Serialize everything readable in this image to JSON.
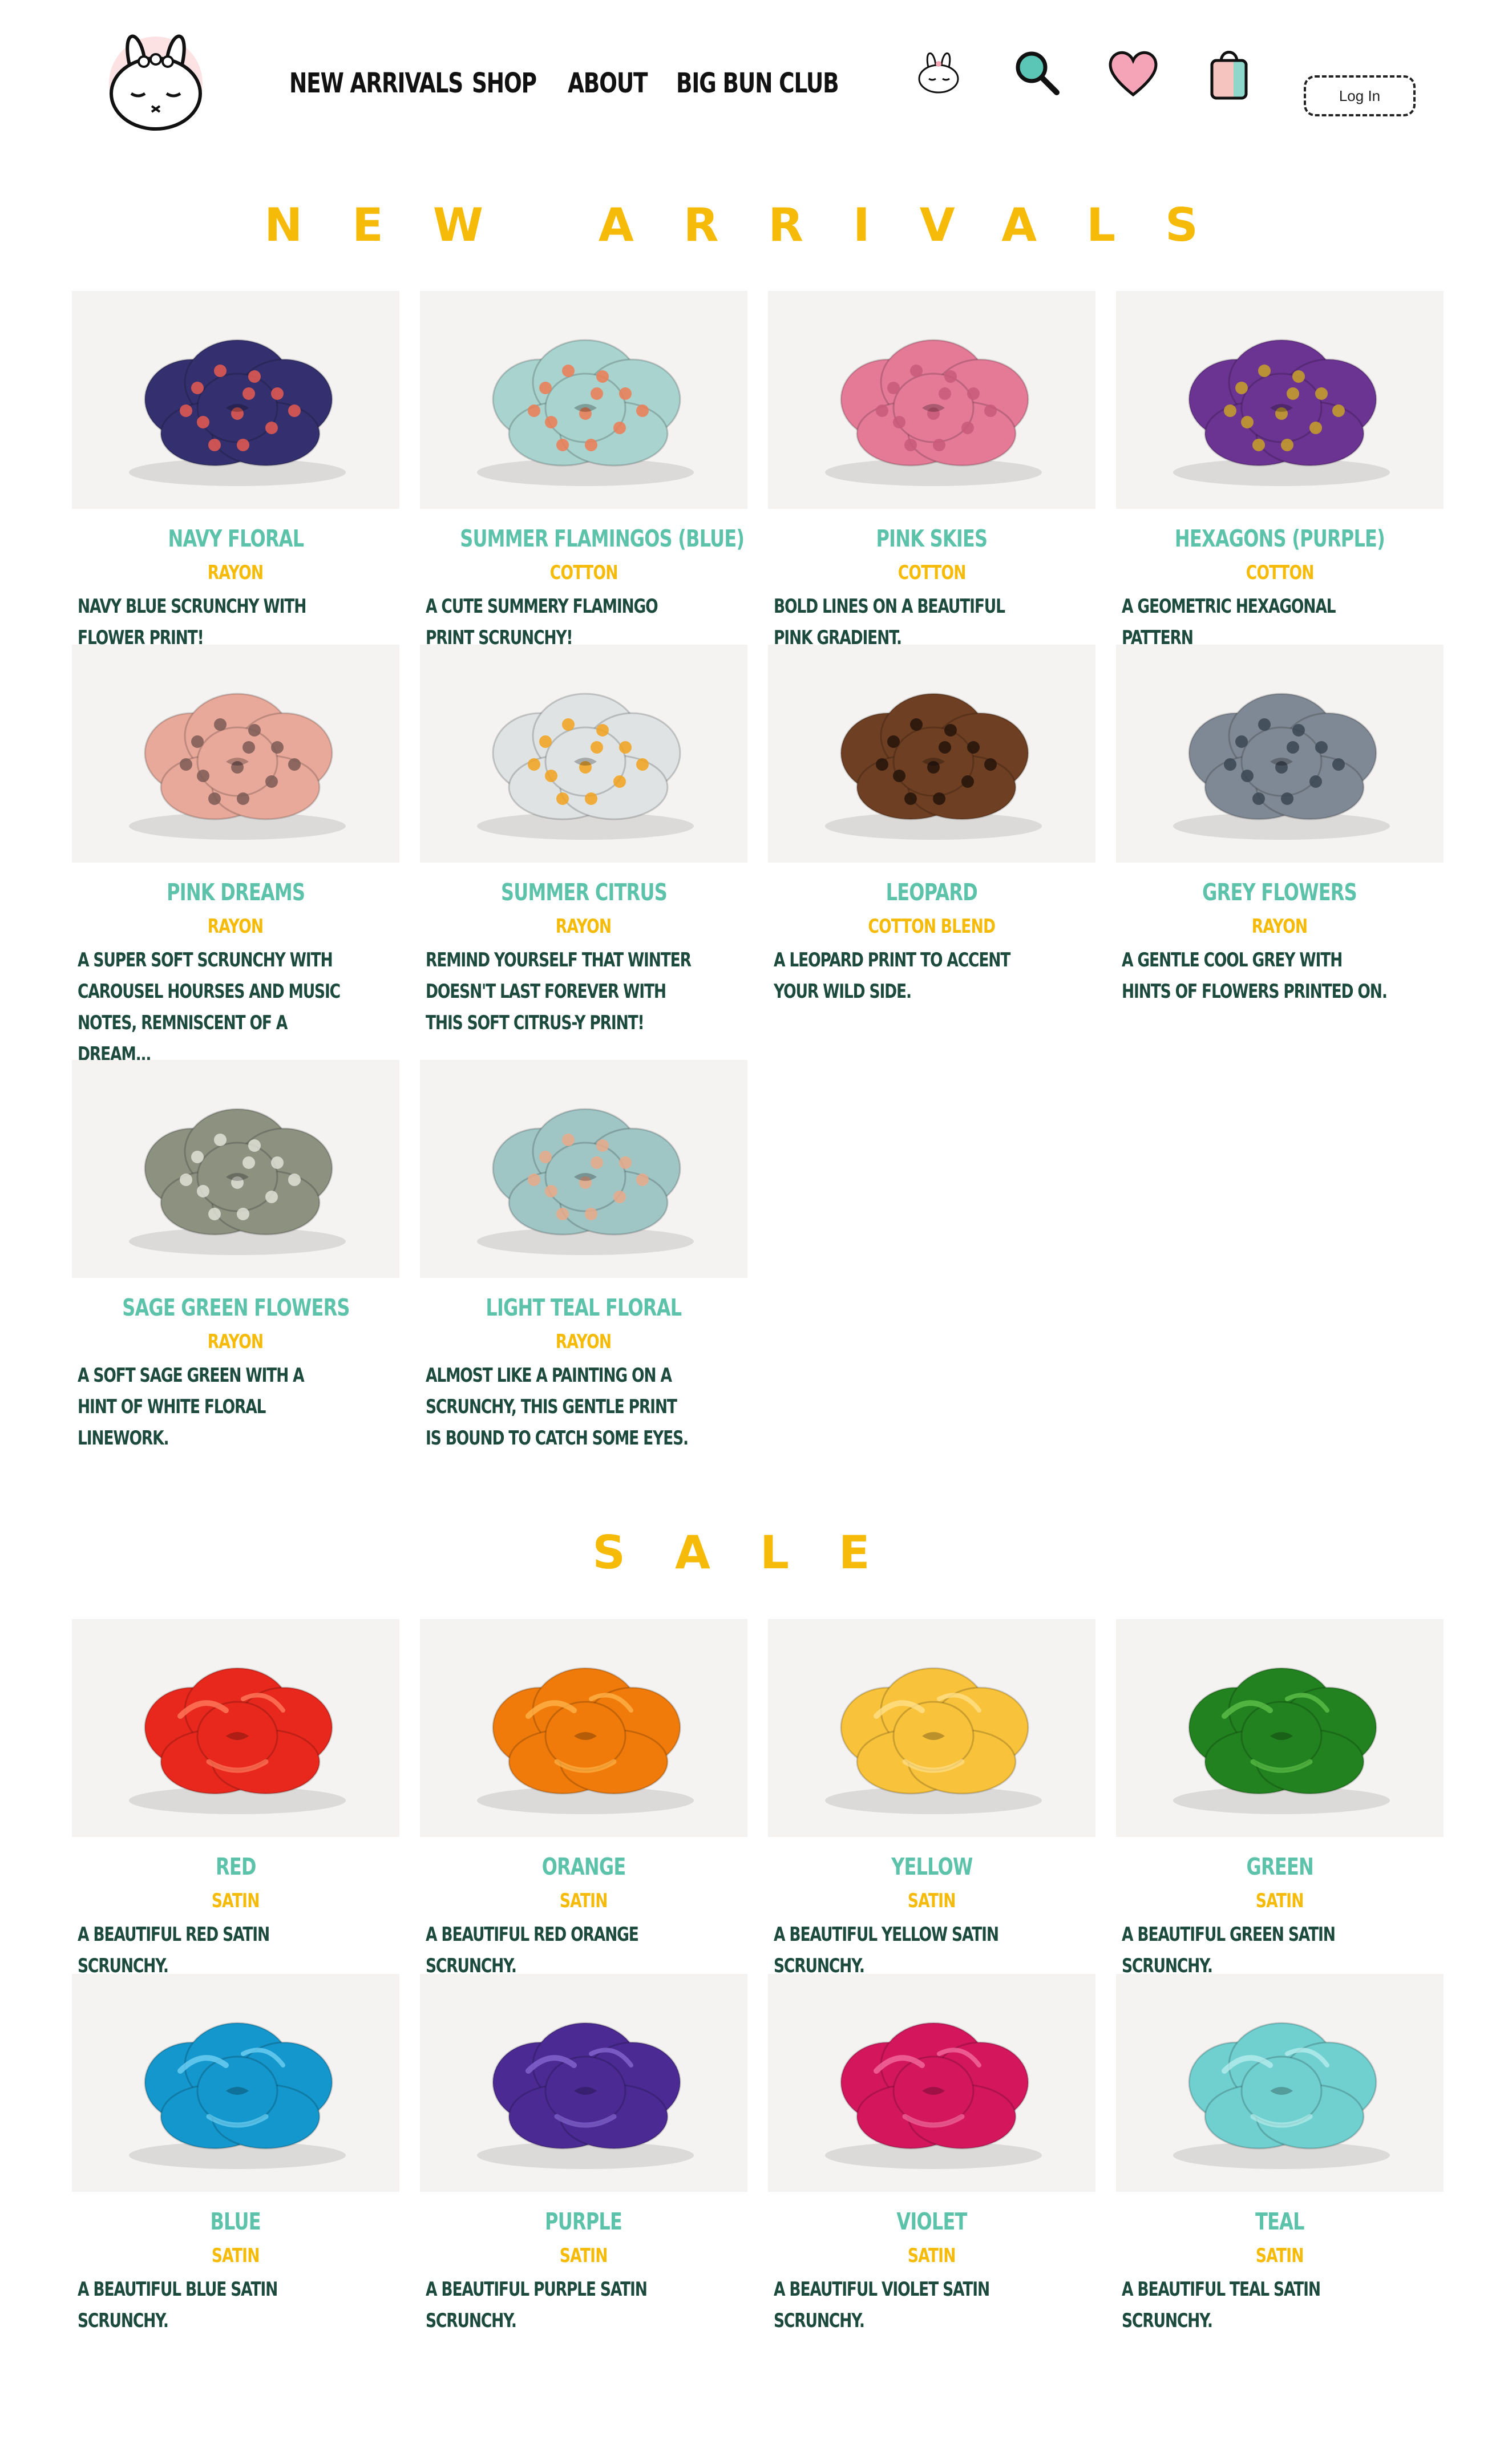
{
  "header": {
    "nav": [
      "NEW ARRIVALS",
      "SHOP",
      "ABOUT",
      "BIG BUN CLUB"
    ],
    "login_label": "Log In",
    "icons": [
      "bunny-logo-icon",
      "bunny-account-icon",
      "search-icon",
      "heart-icon",
      "shopping-bag-icon"
    ]
  },
  "new_arrivals": {
    "title": "NEW ARRIVALS",
    "products": [
      {
        "name": "NAVY FLORAL",
        "material": "RAYON",
        "description": "NAVY BLUE SCRUNCHY WITH FLOWER PRINT!",
        "color": "#34306f",
        "accent": "#e85a50"
      },
      {
        "name": "SUMMER FLAMINGOS (BLUE)",
        "material": "COTTON",
        "description": "A CUTE SUMMERY FLAMINGO PRINT SCRUNCHY!",
        "color": "#a9d3cf",
        "accent": "#ee7b53"
      },
      {
        "name": "PINK SKIES",
        "material": "COTTON",
        "description": "BOLD LINES ON A BEAUTIFUL PINK GRADIENT.",
        "color": "#e57a97",
        "accent": "#c85a78"
      },
      {
        "name": "HEXAGONS (PURPLE)",
        "material": "COTTON",
        "description": "A GEOMETRIC HEXAGONAL PATTERN",
        "color": "#6b3392",
        "accent": "#c9a227"
      },
      {
        "name": "PINK DREAMS",
        "material": "RAYON",
        "description": "A SUPER SOFT SCRUNCHY WITH CAROUSEL HOURSES AND MUSIC NOTES, REMNISCENT OF A DREAM...",
        "color": "#e8a99a",
        "accent": "#7b5a55"
      },
      {
        "name": "SUMMER CITRUS",
        "material": "RAYON",
        "description": "REMIND YOURSELF THAT WINTER DOESN'T LAST FOREVER WITH THIS SOFT CITRUS-Y PRINT!",
        "color": "#dfe3e4",
        "accent": "#f2a21c"
      },
      {
        "name": "LEOPARD",
        "material": "COTTON BLEND",
        "description": "A LEOPARD PRINT TO ACCENT YOUR WILD SIDE.",
        "color": "#6e3f22",
        "accent": "#26140b"
      },
      {
        "name": "GREY FLOWERS",
        "material": "RAYON",
        "description": "A GENTLE COOL GREY WITH HINTS OF FLOWERS PRINTED ON.",
        "color": "#7f8995",
        "accent": "#3b4654"
      },
      {
        "name": "SAGE GREEN FLOWERS",
        "material": "RAYON",
        "description": "A SOFT SAGE GREEN WITH A HINT OF WHITE FLORAL LINEWORK.",
        "color": "#8c9180",
        "accent": "#dfe1d6"
      },
      {
        "name": "LIGHT TEAL FLORAL",
        "material": "RAYON",
        "description": "ALMOST LIKE A PAINTING ON A SCRUNCHY, THIS GENTLE PRINT IS BOUND TO CATCH SOME EYES.",
        "color": "#9fc5c5",
        "accent": "#e9a98a"
      }
    ]
  },
  "sale": {
    "title": "SALE",
    "products": [
      {
        "name": "RED",
        "material": "SATIN",
        "description": "A BEAUTIFUL RED SATIN SCRUNCHY.",
        "color": "#e8281d",
        "accent": "#ff7a5c"
      },
      {
        "name": "ORANGE",
        "material": "SATIN",
        "description": "A BEAUTIFUL RED ORANGE SCRUNCHY.",
        "color": "#f07b0a",
        "accent": "#ffb347"
      },
      {
        "name": "YELLOW",
        "material": "SATIN",
        "description": "A BEAUTIFUL YELLOW SATIN SCRUNCHY.",
        "color": "#f8c23a",
        "accent": "#ffe08a"
      },
      {
        "name": "GREEN",
        "material": "SATIN",
        "description": "A BEAUTIFUL GREEN SATIN SCRUNCHY.",
        "color": "#21821f",
        "accent": "#5ec04a"
      },
      {
        "name": "BLUE",
        "material": "SATIN",
        "description": "A BEAUTIFUL BLUE SATIN SCRUNCHY.",
        "color": "#1497cc",
        "accent": "#6fd0f2"
      },
      {
        "name": "PURPLE",
        "material": "SATIN",
        "description": "A BEAUTIFUL PURPLE SATIN SCRUNCHY.",
        "color": "#4b2a94",
        "accent": "#8566d0"
      },
      {
        "name": "VIOLET",
        "material": "SATIN",
        "description": "A BEAUTIFUL VIOLET SATIN SCRUNCHY.",
        "color": "#d4175d",
        "accent": "#f26c9c"
      },
      {
        "name": "TEAL",
        "material": "SATIN",
        "description": "A BEAUTIFUL TEAL SATIN SCRUNCHY.",
        "color": "#70cfcf",
        "accent": "#b6ecec"
      }
    ]
  },
  "colors": {
    "accent_yellow": "#f6bb08",
    "accent_teal": "#5cc3aa",
    "text_dark_green": "#1c4a3d",
    "nav_text": "#111111"
  }
}
